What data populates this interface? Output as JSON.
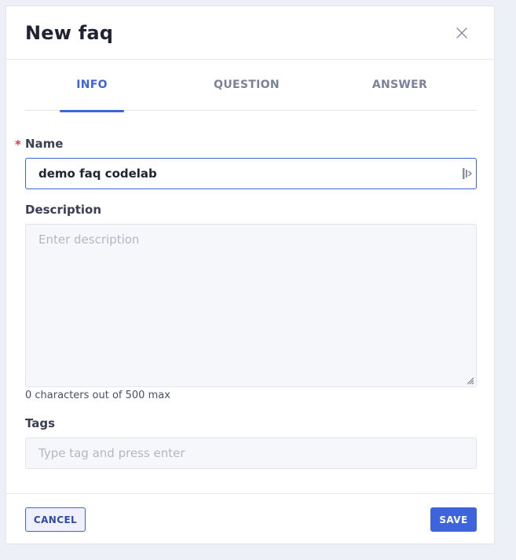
{
  "dialog": {
    "title": "New faq"
  },
  "tabs": [
    {
      "label": "INFO",
      "active": true
    },
    {
      "label": "QUESTION",
      "active": false
    },
    {
      "label": "ANSWER",
      "active": false
    }
  ],
  "form": {
    "name": {
      "required_mark": "*",
      "label": "Name",
      "value": "demo faq codelab"
    },
    "description": {
      "label": "Description",
      "placeholder": "Enter description",
      "value": "",
      "counter_text": "0 characters out of 500 max"
    },
    "tags": {
      "label": "Tags",
      "placeholder": "Type tag and press enter"
    }
  },
  "footer": {
    "cancel_label": "CANCEL",
    "save_label": "SAVE"
  },
  "colors": {
    "accent": "#3d63dd",
    "required": "#d63a4f",
    "background": "#eef0f7"
  },
  "icons": {
    "close": "close-icon",
    "input_suffix": "password-manager-icon",
    "resize": "resize-grip-icon"
  }
}
